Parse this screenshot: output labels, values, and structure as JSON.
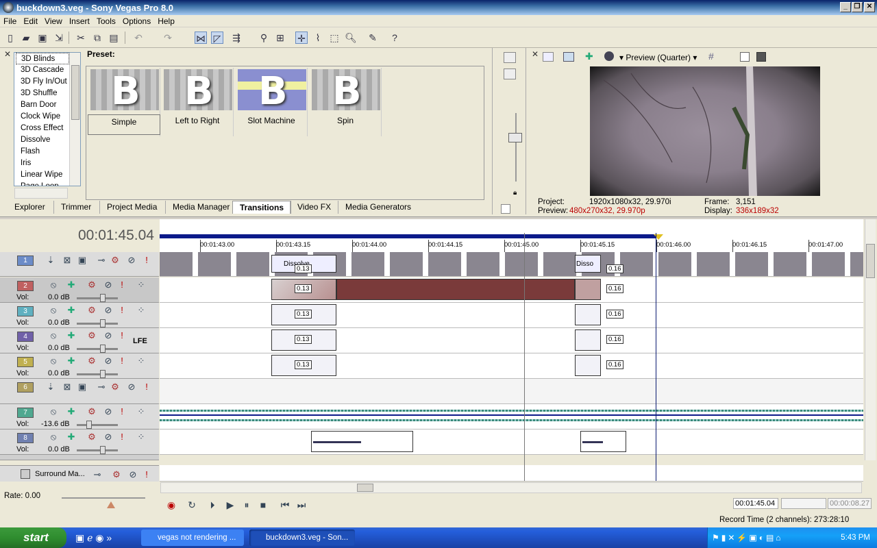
{
  "window": {
    "title": "buckdown3.veg - Sony Vegas Pro 8.0"
  },
  "menu": [
    "File",
    "Edit",
    "View",
    "Insert",
    "Tools",
    "Options",
    "Help"
  ],
  "explorer": {
    "transitions": [
      "3D Blinds",
      "3D Cascade",
      "3D Fly In/Out",
      "3D Shuffle",
      "Barn Door",
      "Clock Wipe",
      "Cross Effect",
      "Dissolve",
      "Flash",
      "Iris",
      "Linear Wipe",
      "Page Loop"
    ],
    "preset_label": "Preset:",
    "presets": [
      "Simple",
      "Left to Right",
      "Slot Machine",
      "Spin"
    ],
    "tabs": [
      "Explorer",
      "Trimmer",
      "Project Media",
      "Media Manager",
      "Transitions",
      "Video FX",
      "Media Generators"
    ],
    "active_tab": "Transitions"
  },
  "preview": {
    "mode": "Preview (Quarter)",
    "project_label": "Project:",
    "project_value": "1920x1080x32, 29.970i",
    "preview_label": "Preview:",
    "preview_value": "480x270x32, 29.970p",
    "frame_label": "Frame:",
    "frame_value": "3,151",
    "display_label": "Display:",
    "display_value": "336x189x32"
  },
  "timeline": {
    "timecode": "00:01:45.04",
    "ruler": [
      "00:01:43.00",
      "00:01:43.15",
      "00:01:44.00",
      "00:01:44.15",
      "00:01:45.00",
      "00:01:45.15",
      "00:01:46.00",
      "00:01:46.15",
      "00:01:47.00"
    ],
    "tracks": [
      {
        "num": "1",
        "type": "video",
        "color": "#6c8cc8"
      },
      {
        "num": "2",
        "type": "audio",
        "vol_label": "Vol:",
        "vol": "0.0 dB",
        "color": "#c06060"
      },
      {
        "num": "3",
        "type": "audio",
        "vol_label": "Vol:",
        "vol": "0.0 dB",
        "color": "#60b0c0"
      },
      {
        "num": "4",
        "type": "audio",
        "vol_label": "Vol:",
        "vol": "0.0 dB",
        "color": "#7060a8",
        "badge": "LFE"
      },
      {
        "num": "5",
        "type": "audio",
        "vol_label": "Vol:",
        "vol": "0.0 dB",
        "color": "#c0b050"
      },
      {
        "num": "6",
        "type": "video",
        "color": "#b0a060"
      },
      {
        "num": "7",
        "type": "audio",
        "vol_label": "Vol:",
        "vol": "-13.6 dB",
        "color": "#50a890"
      },
      {
        "num": "8",
        "type": "audio",
        "vol_label": "Vol:",
        "vol": "0.0 dB",
        "color": "#7080b0"
      }
    ],
    "transition_labels": {
      "dissolve": "Dissolve",
      "dissolve_short": "Disso",
      "left": "0.13",
      "right": "0.16"
    },
    "surround_master": "Surround Ma..."
  },
  "transport": {
    "rate": "Rate: 0.00",
    "time_in": "00:01:45.04",
    "time_len": "00:00:08.27"
  },
  "status": {
    "record_time": "Record Time (2 channels): 273:28:10"
  },
  "taskbar": {
    "start": "start",
    "tasks": [
      "vegas not rendering ...",
      "buckdown3.veg - Son..."
    ],
    "clock": "5:43 PM"
  }
}
